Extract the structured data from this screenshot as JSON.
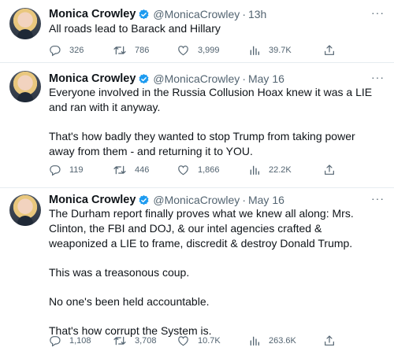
{
  "tweets": [
    {
      "author": "Monica Crowley",
      "handle": "@MonicaCrowley",
      "separator": "·",
      "time": "13h",
      "more": "···",
      "text": [
        "All roads lead to Barack and Hillary"
      ],
      "stats": {
        "replies": "326",
        "retweets": "786",
        "likes": "3,999",
        "views": "39.7K"
      }
    },
    {
      "author": "Monica Crowley",
      "handle": "@MonicaCrowley",
      "separator": "·",
      "time": "May 16",
      "more": "···",
      "text": [
        "Everyone involved in the Russia Collusion Hoax knew it was a LIE and ran with it anyway.",
        "That's how badly they wanted to stop Trump from taking power away from them - and returning it to YOU."
      ],
      "stats": {
        "replies": "119",
        "retweets": "446",
        "likes": "1,866",
        "views": "22.2K"
      }
    },
    {
      "author": "Monica Crowley",
      "handle": "@MonicaCrowley",
      "separator": "·",
      "time": "May 16",
      "more": "···",
      "text": [
        "The Durham report finally proves what we knew all along: Mrs. Clinton, the FBI and DOJ, & our intel agencies crafted & weaponized a LIE to frame, discredit & destroy Donald Trump.",
        "This was a treasonous coup.",
        "No one's been held accountable.",
        "That's how corrupt the System is."
      ],
      "stats": {
        "replies": "1,108",
        "retweets": "3,708",
        "likes": "10.7K",
        "views": "263.6K"
      }
    }
  ],
  "colors": {
    "verified": "#1d9bf0",
    "muted": "#536471",
    "text": "#0f1419"
  },
  "icons": [
    "reply-icon",
    "retweet-icon",
    "like-icon",
    "views-icon",
    "share-icon",
    "verified-badge-icon",
    "more-icon"
  ]
}
